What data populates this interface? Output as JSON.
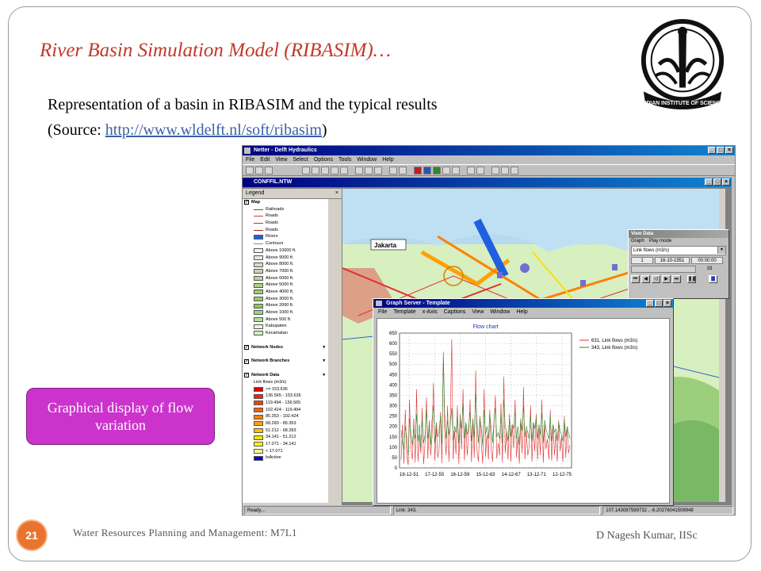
{
  "slide": {
    "title": "River Basin Simulation Model (RIBASIM)…",
    "subtitle": "Representation of a basin in RIBASIM and the typical results",
    "source_prefix": "(Source: ",
    "source_link": "http://www.wldelft.nl/soft/ribasim",
    "source_suffix": ")",
    "callout": "Graphical display of flow variation",
    "page_number": "21",
    "footer_left": "Water Resources Planning and Management: M7L1",
    "footer_right": "D Nagesh Kumar, IISc",
    "logo_text": "INDIAN INSTITUTE OF SCIENCE"
  },
  "colors": {
    "title": "#c0392b",
    "callout_bg": "#cc33cc",
    "badge": "#e8742e",
    "series_1": "#e03030",
    "series_2": "#2a8a2a"
  },
  "app": {
    "window_title": "Netter - Delft Hydraulics",
    "menu": [
      "File",
      "Edit",
      "View",
      "Select",
      "Options",
      "Tools",
      "Window",
      "Help"
    ],
    "network_title": "CONFFIL.NTW",
    "map_label": "Jakarta",
    "legend": {
      "title": "Legend",
      "map_head": "Map",
      "map_items": [
        {
          "label": "Railroads",
          "kind": "line",
          "color": "#555555"
        },
        {
          "label": "Roads",
          "kind": "line",
          "color": "#d04040"
        },
        {
          "label": "Roads",
          "kind": "line",
          "color": "#c03030"
        },
        {
          "label": "Roads",
          "kind": "line",
          "color": "#a02020"
        },
        {
          "label": "Rivers",
          "kind": "swatch",
          "color": "#2060e0"
        },
        {
          "label": "Contours",
          "kind": "line",
          "color": "#888888"
        },
        {
          "label": "Above 10000 ft.",
          "kind": "swatch",
          "color": "#f0f0f0"
        },
        {
          "label": "Above 9000 ft.",
          "kind": "swatch",
          "color": "#e8e8e0"
        },
        {
          "label": "Above 8000 ft.",
          "kind": "swatch",
          "color": "#d8dcc8"
        },
        {
          "label": "Above 7000 ft.",
          "kind": "swatch",
          "color": "#c8d4b0"
        },
        {
          "label": "Above 6000 ft.",
          "kind": "swatch",
          "color": "#b8d498"
        },
        {
          "label": "Above 5000 ft.",
          "kind": "swatch",
          "color": "#a8d480"
        },
        {
          "label": "Above 4000 ft.",
          "kind": "swatch",
          "color": "#98d070"
        },
        {
          "label": "Above 3000 ft.",
          "kind": "swatch",
          "color": "#90d060"
        },
        {
          "label": "Above 2000 ft.",
          "kind": "swatch",
          "color": "#88cc58"
        },
        {
          "label": "Above 1000 ft.",
          "kind": "swatch",
          "color": "#98d878"
        },
        {
          "label": "Above 500 ft.",
          "kind": "swatch",
          "color": "#b0e098"
        },
        {
          "label": "Kabupaten",
          "kind": "swatch",
          "color": "#e8f8d8"
        },
        {
          "label": "Kecamatan",
          "kind": "swatch",
          "color": "#d0f0c0"
        }
      ],
      "network_nodes": "Network Nodes",
      "network_branches": "Network Branches",
      "network_data": "Network Data",
      "data_label": "Link flows (m3/s)",
      "data_items": [
        {
          "label": ">= 153.636",
          "color": "#e00000"
        },
        {
          "label": "136.565 - 153.636",
          "color": "#ff2000"
        },
        {
          "label": "119.494 - 136.565",
          "color": "#ff4000"
        },
        {
          "label": "102.424 - 119.494",
          "color": "#ff6000"
        },
        {
          "label": "85.353 - 102.424",
          "color": "#ff8000"
        },
        {
          "label": "68.283 - 85.353",
          "color": "#ffa000"
        },
        {
          "label": "51.212 - 68.283",
          "color": "#ffc000"
        },
        {
          "label": "34.141 - 51.212",
          "color": "#ffe000"
        },
        {
          "label": "17.071 - 34.141",
          "color": "#ffff00"
        },
        {
          "label": "< 17.071",
          "color": "#ffff80"
        },
        {
          "label": "InActive",
          "color": "#0000e0"
        }
      ]
    },
    "status": {
      "ready": "Ready...",
      "link": "Link: 343,",
      "coords": "107.143087599732 , -6.20276041508948"
    },
    "view_data": {
      "title": "View Data",
      "menu": [
        "Graph",
        "Play mode"
      ],
      "selected": "Link flows (m3/s)",
      "index": "1",
      "date": "16-10-1951",
      "time": "00:00:00",
      "step": "33"
    }
  },
  "graph_window": {
    "title": "Graph Server - Template",
    "menu": [
      "File",
      "Template",
      "x-Axis",
      "Captions",
      "View",
      "Window",
      "Help"
    ]
  },
  "chart_data": {
    "type": "line",
    "title": "Flow chart",
    "xlabel": "",
    "ylabel": "",
    "x_ticks": [
      "18-12-51",
      "17-12-55",
      "16-12-59",
      "15-12-63",
      "14-12-67",
      "13-12-71",
      "12-12-75"
    ],
    "y_ticks": [
      0,
      50,
      100,
      150,
      200,
      250,
      300,
      350,
      400,
      450,
      500,
      550,
      600,
      650
    ],
    "ylim": [
      0,
      650
    ],
    "grid": true,
    "legend": "right",
    "series": [
      {
        "name": "631, Link flows (m3/s)",
        "color": "#e03030",
        "values": [
          40,
          210,
          20,
          280,
          60,
          15,
          330,
          90,
          40,
          240,
          25,
          380,
          30,
          160,
          70,
          290,
          18,
          120,
          340,
          45,
          230,
          60,
          150,
          410,
          35,
          200,
          50,
          90,
          270,
          22,
          560,
          180,
          60,
          300,
          30,
          240,
          620,
          40,
          180,
          65,
          300,
          20,
          260,
          90,
          380,
          35,
          210,
          60,
          170,
          330,
          28,
          240,
          50,
          470,
          80,
          30,
          250,
          120,
          20,
          380,
          55,
          160,
          40,
          280,
          90,
          30,
          220,
          350,
          45,
          120,
          60,
          310,
          25,
          440,
          70,
          180,
          40,
          260,
          30,
          210,
          95,
          330,
          50,
          150,
          20,
          240,
          70,
          390,
          40,
          180,
          60,
          100,
          300,
          30,
          220,
          80,
          260,
          40,
          190,
          60,
          330,
          25,
          210,
          90,
          140,
          40,
          280,
          35,
          200,
          60,
          170,
          30,
          230,
          80,
          150,
          30,
          250,
          50,
          190,
          70,
          110
        ]
      },
      {
        "name": "343, Link flows (m3/s)",
        "color": "#2a8a2a",
        "values": [
          180,
          120,
          90,
          200,
          150,
          60,
          240,
          170,
          110,
          190,
          140,
          260,
          130,
          210,
          100,
          230,
          120,
          160,
          280,
          140,
          200,
          110,
          230,
          300,
          120,
          220,
          150,
          180,
          250,
          110,
          530,
          260,
          140,
          230,
          160,
          210,
          290,
          130,
          200,
          170,
          250,
          120,
          240,
          190,
          310,
          140,
          220,
          160,
          200,
          270,
          130,
          230,
          150,
          360,
          210,
          120,
          240,
          190,
          110,
          280,
          160,
          200,
          140,
          260,
          190,
          120,
          230,
          290,
          150,
          170,
          140,
          260,
          120,
          330,
          200,
          180,
          130,
          240,
          150,
          210,
          190,
          270,
          140,
          200,
          110,
          230,
          180,
          300,
          150,
          200,
          170,
          140,
          250,
          130,
          220,
          190,
          240,
          140,
          210,
          160,
          270,
          120,
          230,
          190,
          160,
          140,
          250,
          130,
          210,
          170,
          190,
          130,
          220,
          180,
          160,
          130,
          230,
          150,
          200,
          170,
          140
        ]
      }
    ]
  }
}
